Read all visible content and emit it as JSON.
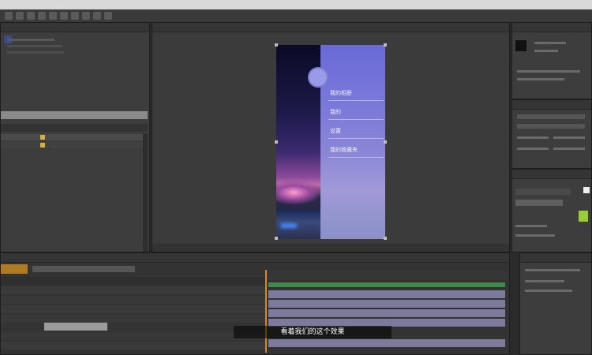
{
  "subtitle": "看着我们的这个效果",
  "accent_colors": {
    "time_indicator": "#d88a20",
    "track_green": "#3d8a4a",
    "menu_purple": "#7a78d8",
    "track_lavender": "#7d7a9c"
  },
  "preview": {
    "menu_items": [
      "我的相册",
      "我的",
      "设置",
      "我的收藏夹"
    ]
  },
  "icons": [
    "composition-handle",
    "playhead"
  ]
}
